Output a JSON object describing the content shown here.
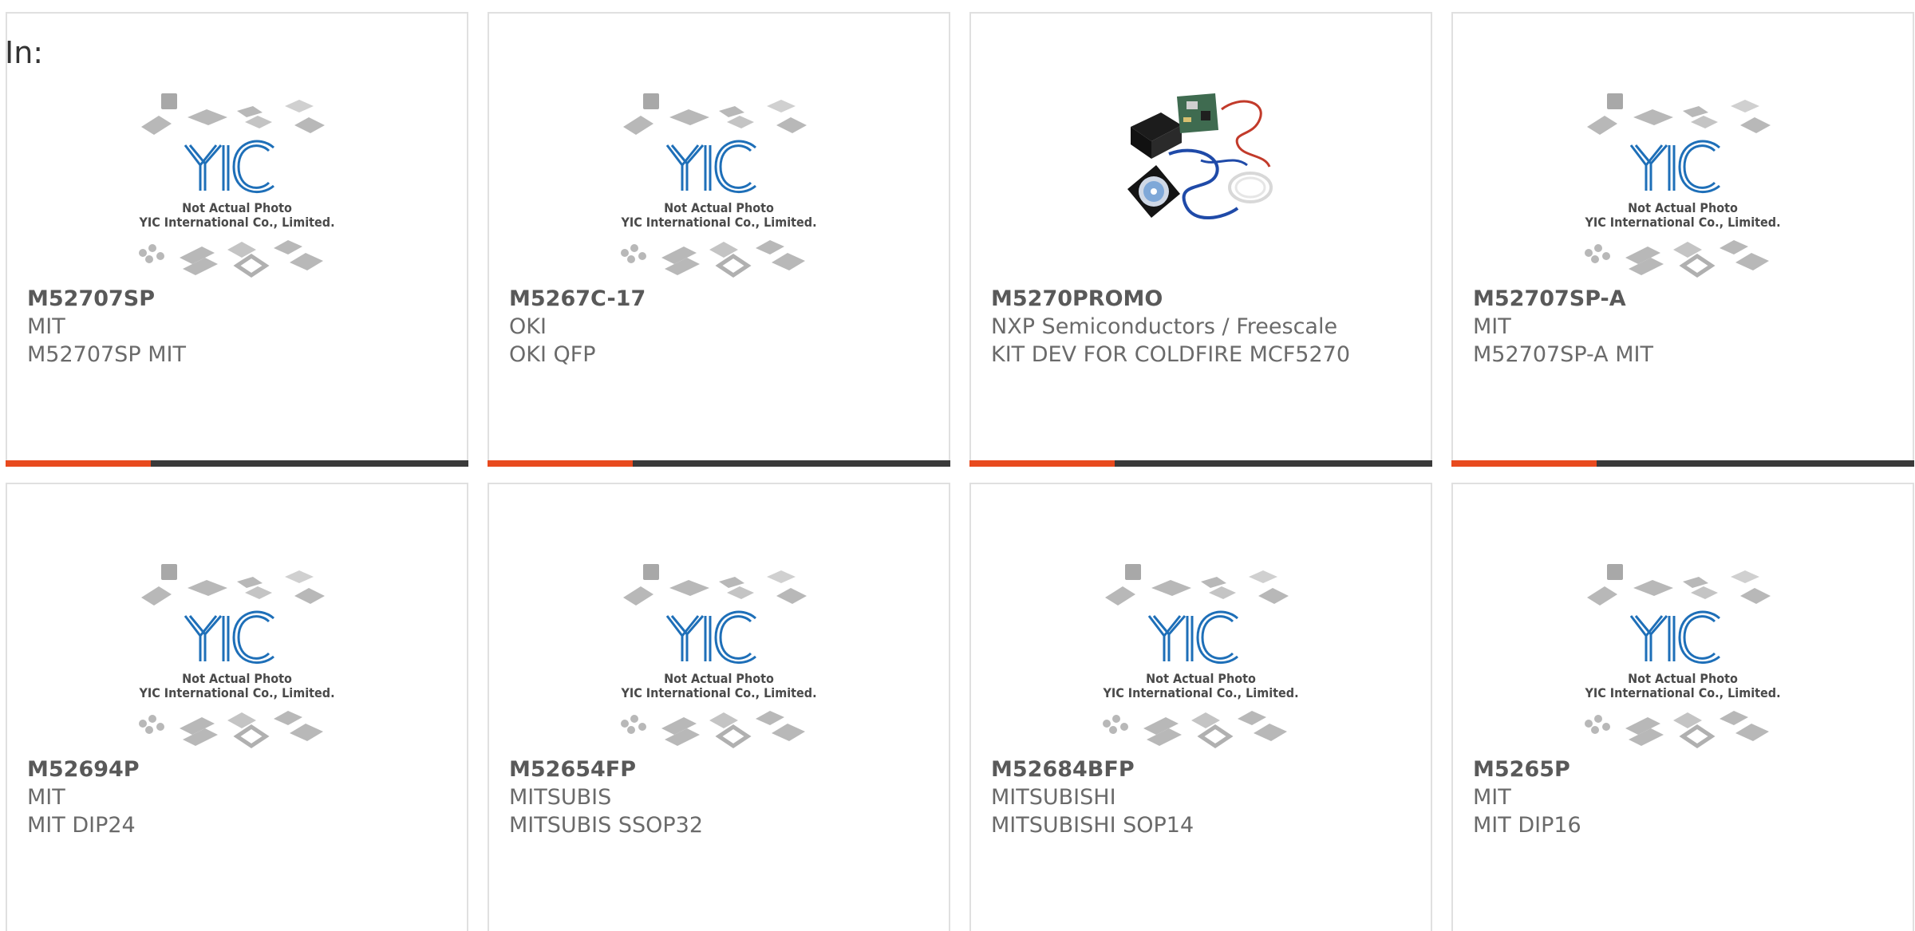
{
  "header": {
    "in_label": "In:"
  },
  "placeholder": {
    "line1": "Not Actual Photo",
    "line2": "YIC International Co., Limited."
  },
  "colors": {
    "accent": "#e84a1e",
    "bar": "#3a3a3a",
    "logo": "#1e6fb8"
  },
  "products": [
    {
      "part": "M52707SP",
      "brand": "MIT",
      "desc": "M52707SP MIT",
      "image": "placeholder"
    },
    {
      "part": "M5267C-17",
      "brand": "OKI",
      "desc": "OKI QFP",
      "image": "placeholder"
    },
    {
      "part": "M5270PROMO",
      "brand": "NXP Semiconductors / Freescale",
      "desc": "KIT DEV FOR COLDFIRE MCF5270",
      "image": "dev-kit-photo"
    },
    {
      "part": "M52707SP-A",
      "brand": "MIT",
      "desc": "M52707SP-A MIT",
      "image": "placeholder"
    },
    {
      "part": "M52694P",
      "brand": "MIT",
      "desc": "MIT DIP24",
      "image": "placeholder"
    },
    {
      "part": "M52654FP",
      "brand": "MITSUBIS",
      "desc": "MITSUBIS SSOP32",
      "image": "placeholder"
    },
    {
      "part": "M52684BFP",
      "brand": "MITSUBISHI",
      "desc": "MITSUBISHI SOP14",
      "image": "placeholder"
    },
    {
      "part": "M5265P",
      "brand": "MIT",
      "desc": "MIT DIP16",
      "image": "placeholder"
    }
  ]
}
